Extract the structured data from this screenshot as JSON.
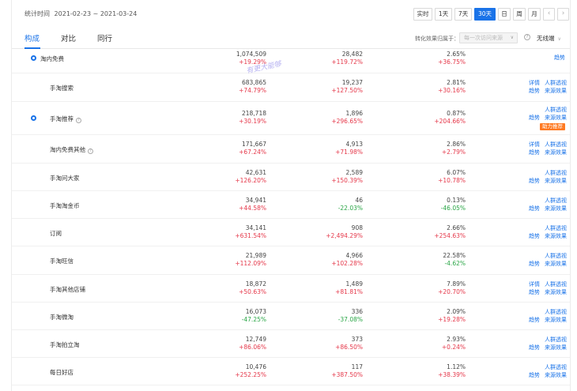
{
  "header": {
    "stat_time_label": "统计时间",
    "date_range": "2021-02-23 ~ 2021-03-24",
    "periods": [
      {
        "label": "实时",
        "active": false
      },
      {
        "label": "1天",
        "active": false
      },
      {
        "label": "7天",
        "active": false
      },
      {
        "label": "30天",
        "active": true
      },
      {
        "label": "日",
        "active": false
      },
      {
        "label": "周",
        "active": false
      },
      {
        "label": "月",
        "active": false
      }
    ],
    "prev_icon": "chevron-left-icon",
    "next_icon": "chevron-right-icon"
  },
  "tabs": [
    {
      "label": "构成",
      "active": true
    },
    {
      "label": "对比",
      "active": false
    },
    {
      "label": "同行",
      "active": false
    }
  ],
  "filters": {
    "effect_label": "转化效果归属于：",
    "effect_select": "每一次访问来源",
    "segment_select": "无线端"
  },
  "watermark": "有更大能够",
  "rows": [
    {
      "name": "淘内免费",
      "dot": true,
      "help": false,
      "v1": "1,074,509",
      "c1": "+19.29%",
      "d1": "up",
      "v2": "28,482",
      "c2": "+119.72%",
      "d2": "up",
      "v3": "2.65%",
      "c3": "+36.75%",
      "d3": "up",
      "ops": [
        [
          "趋势"
        ]
      ],
      "badge": ""
    },
    {
      "name": "手淘搜索",
      "dot": false,
      "help": false,
      "v1": "683,865",
      "c1": "+74.79%",
      "d1": "up",
      "v2": "19,237",
      "c2": "+127.50%",
      "d2": "up",
      "v3": "2.81%",
      "c3": "+30.16%",
      "d3": "up",
      "ops": [
        [
          "详情",
          "人群透视"
        ],
        [
          "趋势",
          "来源效果"
        ]
      ],
      "badge": ""
    },
    {
      "name": "手淘推荐",
      "dot": true,
      "help": true,
      "v1": "218,718",
      "c1": "+30.19%",
      "d1": "up",
      "v2": "1,896",
      "c2": "+296.65%",
      "d2": "up",
      "v3": "0.87%",
      "c3": "+204.66%",
      "d3": "up",
      "ops": [
        [
          "人群透视"
        ],
        [
          "趋势",
          "来源效果"
        ]
      ],
      "badge": "助力推荐"
    },
    {
      "name": "淘内免费其他",
      "dot": false,
      "help": true,
      "v1": "171,667",
      "c1": "+67.24%",
      "d1": "up",
      "v2": "4,913",
      "c2": "+71.98%",
      "d2": "up",
      "v3": "2.86%",
      "c3": "+2.79%",
      "d3": "up",
      "ops": [
        [
          "详情",
          "人群透视"
        ],
        [
          "趋势",
          "来源效果"
        ]
      ],
      "badge": ""
    },
    {
      "name": "手淘问大家",
      "dot": false,
      "help": false,
      "v1": "42,631",
      "c1": "+126.20%",
      "d1": "up",
      "v2": "2,589",
      "c2": "+150.39%",
      "d2": "up",
      "v3": "6.07%",
      "c3": "+10.78%",
      "d3": "up",
      "ops": [
        [
          "人群透视"
        ],
        [
          "趋势",
          "来源效果"
        ]
      ],
      "badge": ""
    },
    {
      "name": "手淘淘金币",
      "dot": false,
      "help": false,
      "v1": "34,941",
      "c1": "+44.58%",
      "d1": "up",
      "v2": "46",
      "c2": "-22.03%",
      "d2": "down",
      "v3": "0.13%",
      "c3": "-46.05%",
      "d3": "down",
      "ops": [
        [
          "人群透视"
        ],
        [
          "趋势",
          "来源效果"
        ]
      ],
      "badge": ""
    },
    {
      "name": "订阅",
      "dot": false,
      "help": false,
      "v1": "34,141",
      "c1": "+631.54%",
      "d1": "up",
      "v2": "908",
      "c2": "+2,494.29%",
      "d2": "up",
      "v3": "2.66%",
      "c3": "+254.63%",
      "d3": "up",
      "ops": [
        [
          "人群透视"
        ],
        [
          "趋势",
          "来源效果"
        ]
      ],
      "badge": ""
    },
    {
      "name": "手淘旺信",
      "dot": false,
      "help": false,
      "v1": "21,989",
      "c1": "+112.09%",
      "d1": "up",
      "v2": "4,966",
      "c2": "+102.28%",
      "d2": "up",
      "v3": "22.58%",
      "c3": "-4.62%",
      "d3": "down",
      "ops": [
        [
          "人群透视"
        ],
        [
          "趋势",
          "来源效果"
        ]
      ],
      "badge": ""
    },
    {
      "name": "手淘其他店铺",
      "dot": false,
      "help": false,
      "v1": "18,872",
      "c1": "+50.63%",
      "d1": "up",
      "v2": "1,489",
      "c2": "+81.81%",
      "d2": "up",
      "v3": "7.89%",
      "c3": "+20.70%",
      "d3": "up",
      "ops": [
        [
          "详情",
          "人群透视"
        ],
        [
          "趋势",
          "来源效果"
        ]
      ],
      "badge": ""
    },
    {
      "name": "手淘微淘",
      "dot": false,
      "help": false,
      "v1": "16,073",
      "c1": "-47.25%",
      "d1": "down",
      "v2": "336",
      "c2": "-37.08%",
      "d2": "down",
      "v3": "2.09%",
      "c3": "+19.28%",
      "d3": "up",
      "ops": [
        [
          "人群透视"
        ],
        [
          "趋势",
          "来源效果"
        ]
      ],
      "badge": ""
    },
    {
      "name": "手淘拍立淘",
      "dot": false,
      "help": false,
      "v1": "12,749",
      "c1": "+86.06%",
      "d1": "up",
      "v2": "373",
      "c2": "+86.50%",
      "d2": "up",
      "v3": "2.93%",
      "c3": "+0.24%",
      "d3": "up",
      "ops": [
        [
          "人群透视"
        ],
        [
          "趋势",
          "来源效果"
        ]
      ],
      "badge": ""
    },
    {
      "name": "每日好店",
      "dot": false,
      "help": false,
      "v1": "10,476",
      "c1": "+252.25%",
      "d1": "up",
      "v2": "117",
      "c2": "+387.50%",
      "d2": "up",
      "v3": "1.12%",
      "c3": "+38.39%",
      "d3": "up",
      "ops": [
        [
          "人群透视"
        ],
        [
          "趋势",
          "来源效果"
        ]
      ],
      "badge": ""
    }
  ]
}
